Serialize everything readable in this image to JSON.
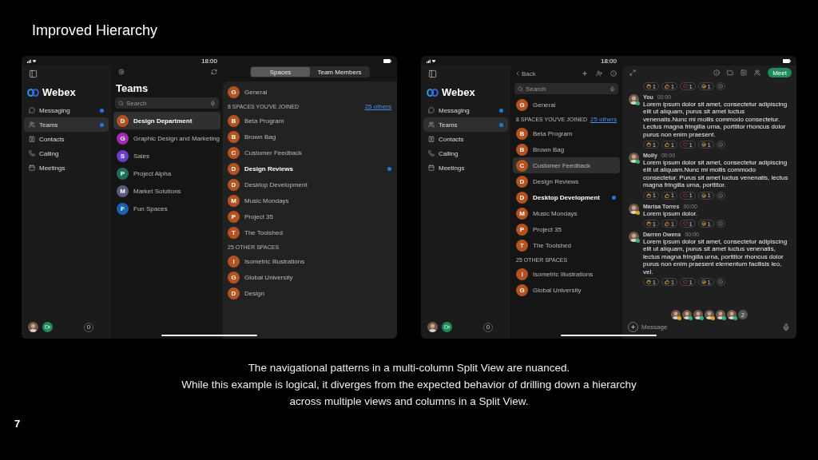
{
  "slide": {
    "title": "Improved Hierarchy",
    "caption": [
      "The navigational patterns in a multi-column Split View are nuanced.",
      "While this example is logical, it diverges from the expected behavior of drilling down a hierarchy",
      "across multiple views and columns in a Split View."
    ],
    "page_number": "7"
  },
  "left": {
    "time": "18:00",
    "sidebar": {
      "brand": "Webex",
      "items": [
        {
          "label": "Messaging",
          "selected": false,
          "unread": true
        },
        {
          "label": "Teams",
          "selected": true,
          "unread": true
        },
        {
          "label": "Contacts",
          "selected": false,
          "unread": false
        },
        {
          "label": "Calling",
          "selected": false,
          "unread": false
        },
        {
          "label": "Meetings",
          "selected": false,
          "unread": false
        }
      ],
      "badge": "0"
    },
    "teams": {
      "title": "Teams",
      "search_placeholder": "Search",
      "items": [
        {
          "letter": "D",
          "name": "Design Department",
          "color": "#b4531f",
          "selected": true
        },
        {
          "letter": "G",
          "name": "Graphic Design and Marketing",
          "color": "#a02bb5",
          "selected": false
        },
        {
          "letter": "S",
          "name": "Sales",
          "color": "#6a3fc8",
          "selected": false
        },
        {
          "letter": "P",
          "name": "Project Alpha",
          "color": "#1f6f5c",
          "selected": false
        },
        {
          "letter": "M",
          "name": "Market Solutions",
          "color": "#5b5a7a",
          "selected": false
        },
        {
          "letter": "F",
          "name": "Fun Spaces",
          "color": "#1a62b0",
          "selected": false
        }
      ]
    },
    "spaces": {
      "tabs": [
        {
          "label": "Spaces",
          "selected": true
        },
        {
          "label": "Team Members",
          "selected": false
        }
      ],
      "general": {
        "letter": "G",
        "name": "General"
      },
      "sections": [
        {
          "heading": "8 SPACES YOU'VE JOINED",
          "link": "25 others",
          "items": [
            {
              "letter": "B",
              "name": "Beta Program",
              "selected": false,
              "unread": false
            },
            {
              "letter": "B",
              "name": "Brown Bag",
              "selected": false,
              "unread": false
            },
            {
              "letter": "C",
              "name": "Customer Feedback",
              "selected": false,
              "unread": false
            },
            {
              "letter": "D",
              "name": "Design Reviews",
              "selected": false,
              "unread": true
            },
            {
              "letter": "D",
              "name": "Desktop Development",
              "selected": false,
              "unread": false
            },
            {
              "letter": "M",
              "name": "Music Mondays",
              "selected": false,
              "unread": false
            },
            {
              "letter": "P",
              "name": "Project 35",
              "selected": false,
              "unread": false
            },
            {
              "letter": "T",
              "name": "The Toolshed",
              "selected": false,
              "unread": false
            }
          ]
        },
        {
          "heading": "25 OTHER SPACES",
          "items": [
            {
              "letter": "I",
              "name": "Isometric Illustrations",
              "selected": false,
              "unread": false
            },
            {
              "letter": "G",
              "name": "Global University",
              "selected": false,
              "unread": false
            },
            {
              "letter": "D",
              "name": "Design",
              "selected": false,
              "unread": false
            }
          ]
        }
      ]
    }
  },
  "right": {
    "time": "18:00",
    "sidebar": {
      "brand": "Webex",
      "items": [
        {
          "label": "Messaging",
          "selected": false,
          "unread": true
        },
        {
          "label": "Teams",
          "selected": true,
          "unread": true
        },
        {
          "label": "Contacts",
          "selected": false,
          "unread": false
        },
        {
          "label": "Calling",
          "selected": false,
          "unread": false
        },
        {
          "label": "Meetings",
          "selected": false,
          "unread": false
        }
      ],
      "badge": "0"
    },
    "spaces": {
      "back": "Back",
      "search_placeholder": "Search",
      "general": {
        "letter": "G",
        "name": "General"
      },
      "sections": [
        {
          "heading": "8 SPACES YOU'VE JOINED",
          "link": "25 others",
          "items": [
            {
              "letter": "B",
              "name": "Beta Program",
              "selected": false,
              "unread": false
            },
            {
              "letter": "B",
              "name": "Brown Bag",
              "selected": false,
              "unread": false
            },
            {
              "letter": "C",
              "name": "Customer Feedback",
              "selected": true,
              "unread": false
            },
            {
              "letter": "D",
              "name": "Design Reviews",
              "selected": false,
              "unread": false
            },
            {
              "letter": "D",
              "name": "Desktop Development",
              "selected": false,
              "unread": true
            },
            {
              "letter": "M",
              "name": "Music Mondays",
              "selected": false,
              "unread": false
            },
            {
              "letter": "P",
              "name": "Project 35",
              "selected": false,
              "unread": false
            },
            {
              "letter": "T",
              "name": "The Toolshed",
              "selected": false,
              "unread": false
            }
          ]
        },
        {
          "heading": "25 OTHER SPACES",
          "items": [
            {
              "letter": "I",
              "name": "Isometric Illustrations",
              "selected": false,
              "unread": false
            },
            {
              "letter": "G",
              "name": "Global University",
              "selected": false,
              "unread": false
            }
          ]
        }
      ]
    },
    "chat": {
      "meet": "Meet",
      "top_reactions": [
        {
          "kind": "clap",
          "count": "1"
        },
        {
          "kind": "thumbs",
          "count": "1"
        },
        {
          "kind": "heart",
          "count": "1"
        },
        {
          "kind": "laugh",
          "count": "1"
        }
      ],
      "messages": [
        {
          "author": "You",
          "time": "00:00",
          "color": "#2bb673",
          "text": "Lorem ipsum dolor sit amet, consectetur adipiscing elit ut aliquam, purus sit amet luctus venenatis.Nunc mi mollis commodo consectetur. Lectus magna fringilla urna, porttitor rhoncus dolor purus non enim praesent.",
          "reactions": [
            {
              "kind": "clap",
              "count": "1"
            },
            {
              "kind": "thumbs",
              "count": "1"
            },
            {
              "kind": "heart",
              "count": "1"
            },
            {
              "kind": "laugh",
              "count": "1"
            }
          ]
        },
        {
          "author": "Molly",
          "time": "00:00",
          "color": "#2bb673",
          "text": "Lorem ipsum dolor sit amet, consectetur adipiscing elit ut aliquam.Nunc mi mollis commodo consectetur. Purus sit amet luctus venenatis, lectus magna fringilla urna, porttitor.",
          "reactions": [
            {
              "kind": "clap",
              "count": "1"
            },
            {
              "kind": "thumbs",
              "count": "1"
            },
            {
              "kind": "heart",
              "count": "1"
            },
            {
              "kind": "laugh",
              "count": "1"
            }
          ]
        },
        {
          "author": "Marisa Torres",
          "time": "00:00",
          "color": "#e6a117",
          "text": "Lorem ipsum dolor.",
          "reactions": [
            {
              "kind": "clap",
              "count": "1"
            },
            {
              "kind": "thumbs",
              "count": "1"
            },
            {
              "kind": "heart",
              "count": "1"
            },
            {
              "kind": "laugh",
              "count": "1"
            }
          ]
        },
        {
          "author": "Darren Owens",
          "time": "00:00",
          "color": "#2bb673",
          "text": "Lorem ipsum dolor sit amet, consectetur adipiscing elit ut aliquam, purus sit amet luctus venenatis, lectus magna fringilla urna, porttitor rhoncus dolor purus non enim praesent elementum facilisis leo, vel.",
          "reactions": [
            {
              "kind": "clap",
              "count": "1"
            },
            {
              "kind": "thumbs",
              "count": "1"
            },
            {
              "kind": "heart",
              "count": "1"
            },
            {
              "kind": "laugh",
              "count": "1"
            }
          ]
        }
      ],
      "participants": [
        {
          "color": "#e6a117"
        },
        {
          "color": "#2bb673"
        },
        {
          "color": "#2bb673"
        },
        {
          "color": "#e6a117"
        },
        {
          "color": "#2bb673"
        },
        {
          "color": "#2bb673"
        }
      ],
      "more": "2",
      "message_placeholder": "Message"
    }
  }
}
